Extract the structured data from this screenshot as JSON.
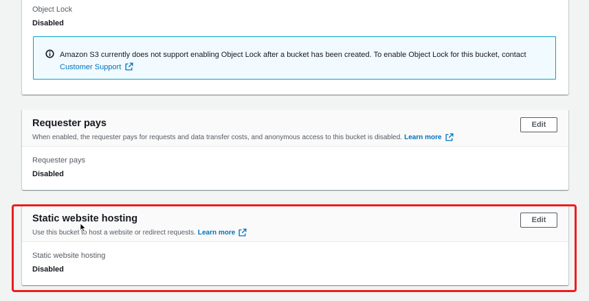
{
  "object_lock": {
    "label": "Object Lock",
    "value": "Disabled",
    "alert": {
      "text": "Amazon S3 currently does not support enabling Object Lock after a bucket has been created. To enable Object Lock for this bucket, contact",
      "link": "Customer Support"
    }
  },
  "requester_pays": {
    "title": "Requester pays",
    "description": "When enabled, the requester pays for requests and data transfer costs, and anonymous access to this bucket is disabled.",
    "learn_more": "Learn more",
    "edit_label": "Edit",
    "field_label": "Requester pays",
    "field_value": "Disabled"
  },
  "static_website_hosting": {
    "title": "Static website hosting",
    "description": "Use this bucket to host a website or redirect requests.",
    "learn_more": "Learn more",
    "edit_label": "Edit",
    "field_label": "Static website hosting",
    "field_value": "Disabled"
  },
  "colors": {
    "link": "#0073bb",
    "alert_border": "#00a1c9",
    "alert_bg": "#f1faff",
    "highlight": "#ec1c1c"
  },
  "icons": {
    "info": "info-icon",
    "external_link": "external-link-icon",
    "cursor": "mouse-cursor-icon"
  }
}
